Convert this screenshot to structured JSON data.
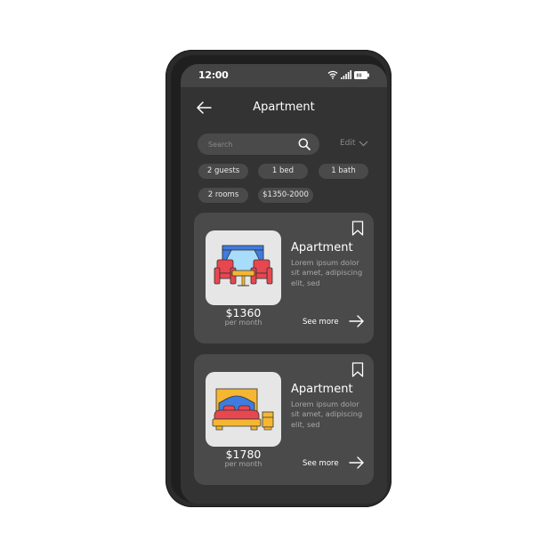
{
  "status_bar": {
    "time": "12:00",
    "icons": [
      "wifi-icon",
      "signal-icon",
      "battery-icon"
    ]
  },
  "header": {
    "back_icon": "arrow-left-icon",
    "title": "Apartment"
  },
  "search": {
    "placeholder": "Search",
    "value": "",
    "icon": "search-icon"
  },
  "edit": {
    "label": "Edit",
    "icon": "chevron-down-icon"
  },
  "filters": [
    {
      "label": "2 guests"
    },
    {
      "label": "1 bed"
    },
    {
      "label": "1 bath"
    },
    {
      "label": "2 rooms"
    },
    {
      "label": "$1350-2000"
    }
  ],
  "listings": [
    {
      "title": "Apartment",
      "description": "Lorem ipsum dolor sit amet, adipiscing elit, sed",
      "price": "$1360",
      "period": "per month",
      "see_more": "See more",
      "image": "living-room-icon",
      "bookmark_icon": "bookmark-icon",
      "arrow_icon": "arrow-right-icon"
    },
    {
      "title": "Apartment",
      "description": "Lorem ipsum dolor sit amet, adipiscing elit, sed",
      "price": "$1780",
      "period": "per month",
      "see_more": "See more",
      "image": "bedroom-icon",
      "bookmark_icon": "bookmark-icon",
      "arrow_icon": "arrow-right-icon"
    }
  ],
  "colors": {
    "screen_bg": "#333333",
    "card_bg": "#4a4a4a",
    "chip_bg": "#4a4a4a",
    "text_primary": "#ffffff",
    "text_secondary": "#a8a8a8",
    "accent_red": "#e8474f",
    "accent_yellow": "#f5b731",
    "accent_blue": "#3f7be0",
    "accent_light_blue": "#a8dcfb"
  }
}
